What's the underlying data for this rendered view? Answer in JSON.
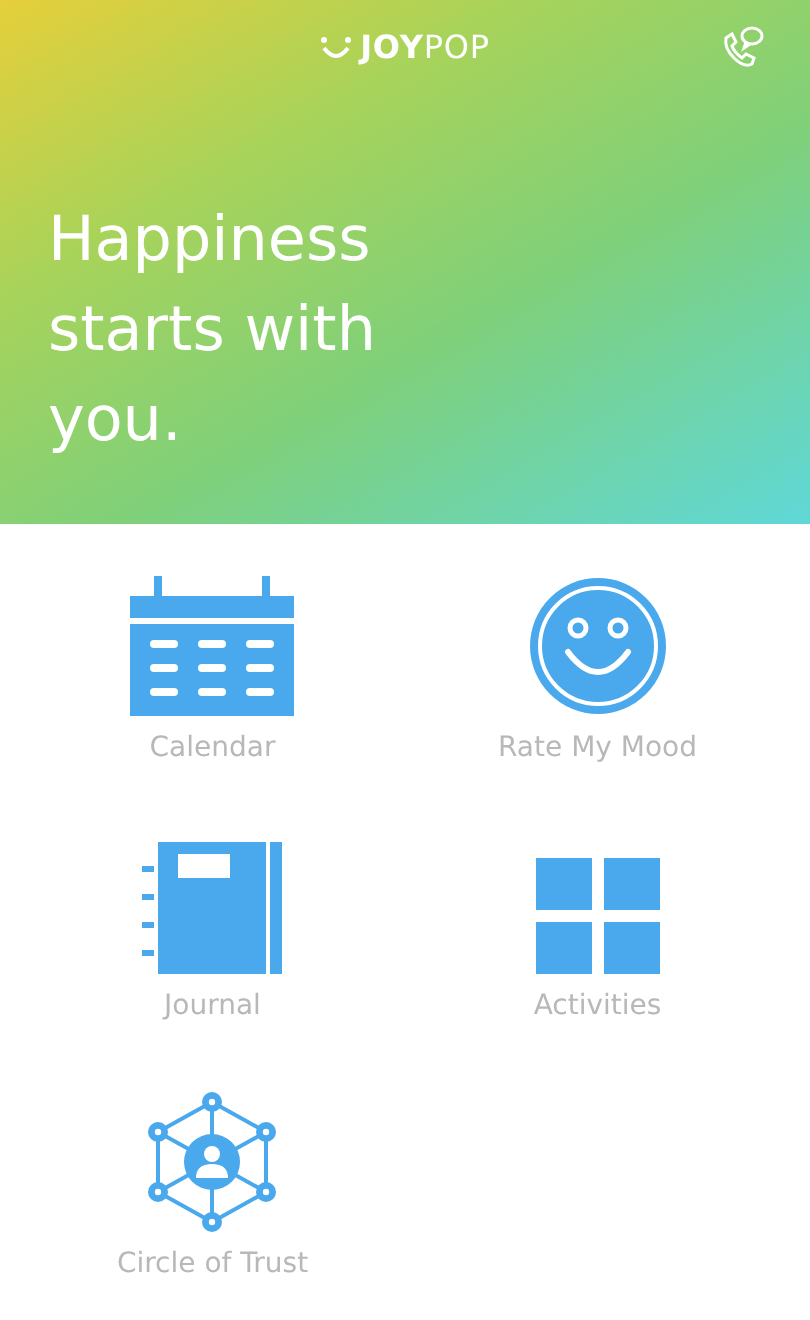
{
  "header": {
    "logo": "**JOY**POP",
    "headline": "Happiness starts with you."
  },
  "tiles": [
    {
      "kind": "calendar",
      "label": "Calendar"
    },
    {
      "kind": "mood",
      "label": "Rate My Mood"
    },
    {
      "kind": "journal",
      "label": "Journal"
    },
    {
      "kind": "activities",
      "label": "Activities"
    },
    {
      "kind": "network",
      "label": "Circle of Trust"
    }
  ]
}
